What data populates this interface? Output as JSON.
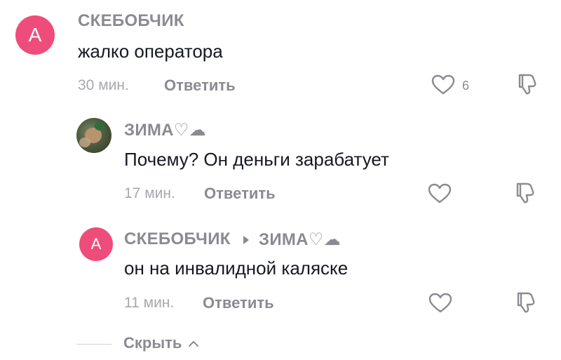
{
  "comments": [
    {
      "avatar_letter": "A",
      "username": "СКЕБОБЧИК",
      "text": "жалко оператора",
      "time": "30 мин.",
      "reply_label": "Ответить",
      "likes": "6"
    },
    {
      "avatar": "photo",
      "username": "ЗИМА♡☁",
      "text": "Почему? Он деньги зарабатует",
      "time": "17 мин.",
      "reply_label": "Ответить"
    },
    {
      "avatar_letter": "A",
      "username": "СКЕБОБЧИК",
      "reply_to": "ЗИМА♡☁",
      "text": "он на инвалидной каляске",
      "time": "11 мин.",
      "reply_label": "Ответить"
    }
  ],
  "hide_replies_label": "Скрыть",
  "colors": {
    "avatar_bg": "#ee4d7b",
    "muted": "#8a8b91",
    "text": "#161823"
  },
  "icons": [
    "heart-outline-icon",
    "dislike-icon",
    "chevron-up-icon"
  ]
}
